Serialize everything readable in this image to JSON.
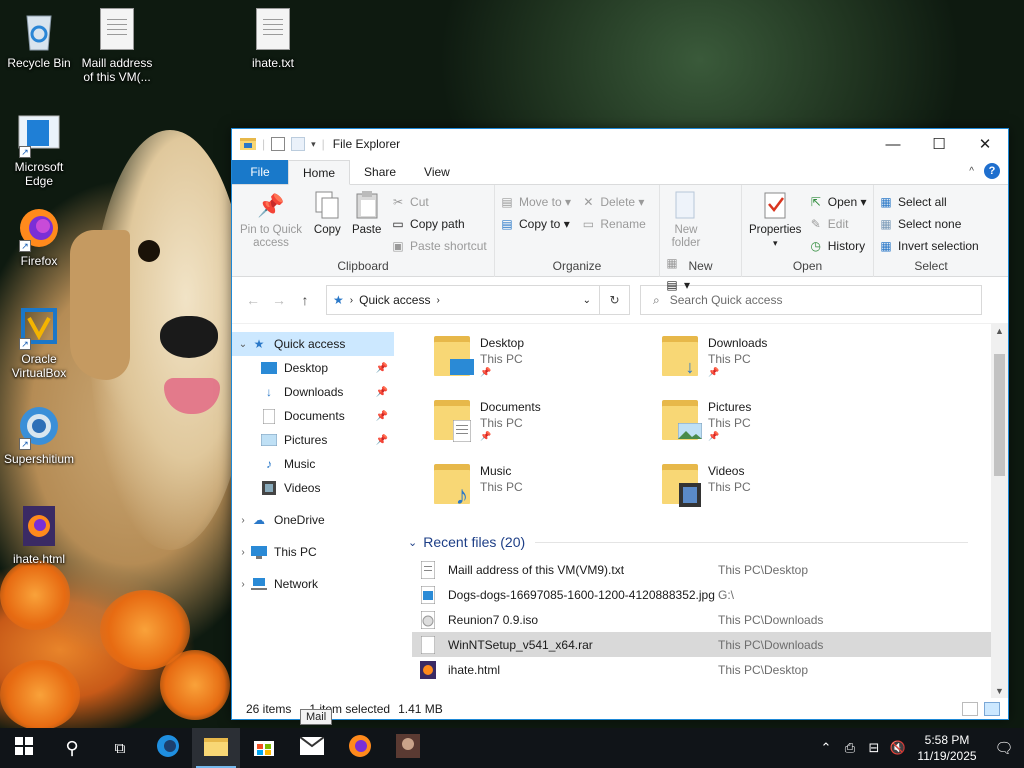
{
  "desktop": {
    "icons": [
      {
        "label": "Recycle Bin",
        "icon": "recycle-bin-icon"
      },
      {
        "label": "Maill address of this VM(...",
        "icon": "text-file-icon"
      },
      {
        "label": "ihate.txt",
        "icon": "text-file-icon"
      },
      {
        "label": "Microsoft Edge",
        "icon": "edge-icon"
      },
      {
        "label": "Firefox",
        "icon": "firefox-icon"
      },
      {
        "label": "Oracle VirtualBox",
        "icon": "virtualbox-icon"
      },
      {
        "label": "Supershitium",
        "icon": "chromium-icon"
      },
      {
        "label": "ihate.html",
        "icon": "firefox-html-icon"
      }
    ]
  },
  "window": {
    "title": "File Explorer",
    "tabs": [
      "File",
      "Home",
      "Share",
      "View"
    ],
    "ribbon": {
      "clipboard": {
        "label": "Clipboard",
        "pin": "Pin to Quick access",
        "copy": "Copy",
        "paste": "Paste",
        "cut": "Cut",
        "copy_path": "Copy path",
        "paste_shortcut": "Paste shortcut"
      },
      "organize": {
        "label": "Organize",
        "move_to": "Move to",
        "copy_to": "Copy to",
        "delete": "Delete",
        "rename": "Rename"
      },
      "new": {
        "label": "New",
        "new_folder": "New folder"
      },
      "open": {
        "label": "Open",
        "properties": "Properties",
        "open": "Open",
        "edit": "Edit",
        "history": "History"
      },
      "select": {
        "label": "Select",
        "select_all": "Select all",
        "select_none": "Select none",
        "invert": "Invert selection"
      }
    },
    "address": {
      "path": "Quick access",
      "search_placeholder": "Search Quick access"
    },
    "nav": {
      "quick_access": "Quick access",
      "items": [
        {
          "label": "Desktop",
          "pinned": true
        },
        {
          "label": "Downloads",
          "pinned": true
        },
        {
          "label": "Documents",
          "pinned": true
        },
        {
          "label": "Pictures",
          "pinned": true
        },
        {
          "label": "Music",
          "pinned": false
        },
        {
          "label": "Videos",
          "pinned": false
        }
      ],
      "onedrive": "OneDrive",
      "this_pc": "This PC",
      "network": "Network"
    },
    "folders": [
      {
        "name": "Desktop",
        "location": "This PC"
      },
      {
        "name": "Downloads",
        "location": "This PC"
      },
      {
        "name": "Documents",
        "location": "This PC"
      },
      {
        "name": "Pictures",
        "location": "This PC"
      },
      {
        "name": "Music",
        "location": "This PC"
      },
      {
        "name": "Videos",
        "location": "This PC"
      }
    ],
    "recent_header": "Recent files (20)",
    "recent_files": [
      {
        "name": "Maill address of this VM(VM9).txt",
        "location": "This PC\\Desktop"
      },
      {
        "name": "Dogs-dogs-16697085-1600-1200-4120888352.jpg",
        "location": "G:\\"
      },
      {
        "name": "Reunion7 0.9.iso",
        "location": "This PC\\Downloads"
      },
      {
        "name": "WinNTSetup_v541_x64.rar",
        "location": "This PC\\Downloads"
      },
      {
        "name": "ihate.html",
        "location": "This PC\\Desktop"
      }
    ],
    "status": {
      "items": "26 items",
      "selected": "1 item selected",
      "size": "1.41 MB"
    }
  },
  "tooltip": "Mail",
  "taskbar": {
    "time": "5:58 PM",
    "date": "11/19/2025"
  },
  "colors": {
    "accent": "#1979ca",
    "selection": "#cce8ff"
  }
}
